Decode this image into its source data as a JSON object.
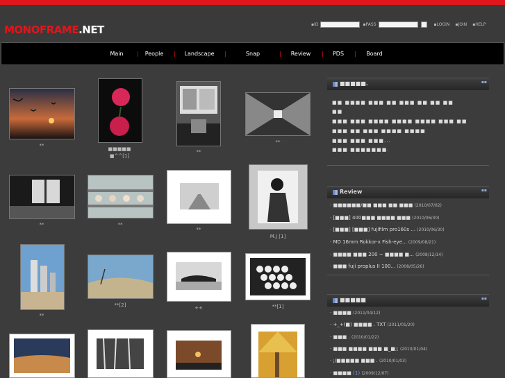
{
  "logo": {
    "part1": "MONOFRAME",
    "part2": ".NET"
  },
  "login": {
    "id_label": "ID",
    "pass_label": "PASS",
    "login_link": "LOGIN",
    "join_link": "JOIN",
    "help_link": "HELP"
  },
  "nav": {
    "items": [
      "Main",
      "People",
      "Landscape",
      "Snap",
      "Review",
      "PDS",
      "Board"
    ]
  },
  "gallery": {
    "captions": [
      "**",
      "■■■■■\n■^^[1]",
      "**",
      "**",
      "**",
      "**",
      "**",
      "M.J [1]",
      "**",
      "**[2]",
      "++",
      "**[1]"
    ]
  },
  "notice": {
    "title": "■■■■■.",
    "lines": [
      "■■ ■■■■ ■■■ ■■ ■■■ ■■ ■■ ■■",
      "■■",
      "■■■ ■■■ ■■■■ ■■■■ ■■■■ ■■■ ■■",
      "■■■ ■■ ■■■ ■■■■ ■■■■",
      "■■■ ■■■ ■■■...",
      "■■■ ■■■■■■■."
    ]
  },
  "review": {
    "title": "Review",
    "rows": [
      {
        "text": "■■■■■■/■■ ■■■ ■■ ■■■",
        "date": "(2010/07/02)"
      },
      {
        "text": "[■■■] 400■■■ ■■■■ ■■■",
        "date": "(2010/06/30)"
      },
      {
        "text": "[■■■] [■■■] fujifilm pro160s ...",
        "date": "(2010/06/30)"
      },
      {
        "text": "MD 16mm Rokkor-x Fish-eye...",
        "date": "(2009/08/21)"
      },
      {
        "text": "■■■■ ■■■ 200 ~ ■■■■ ■...",
        "date": "(2008/12/14)"
      },
      {
        "text": "■■■ fuji proplus II 100...",
        "date": "(2008/05/26)"
      }
    ]
  },
  "board": {
    "title": "■■■■■",
    "rows": [
      {
        "text": "■■■■",
        "num": "",
        "date": "(2011/04/12)"
      },
      {
        "text": "+_+(■) ■■■■ . TXT",
        "num": "",
        "date": "(2011/01/20)"
      },
      {
        "text": "■■■ .",
        "num": "",
        "date": "(2010/01/22)"
      },
      {
        "text": "■■■ ■■■■ ■■■ ■_■;;",
        "num": "",
        "date": "(2010/01/04)"
      },
      {
        "text": ";/■■■■■ ■■■ .",
        "num": "",
        "date": "(2010/01/03)"
      },
      {
        "text": "■■■■",
        "num": "(1)",
        "date": "(2009/12/07)"
      }
    ]
  },
  "colors": {
    "accent": "#e0161c",
    "link": "#7aa0ff",
    "background": "#3c3c3c"
  }
}
